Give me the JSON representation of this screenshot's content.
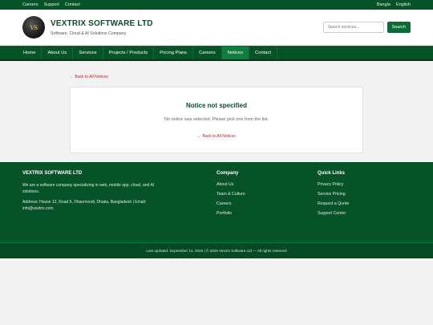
{
  "topbar": {
    "links": [
      "Careers",
      "Support",
      "Contact"
    ],
    "languages": [
      "Bangla",
      "English"
    ]
  },
  "header": {
    "logo_text": "VS",
    "company_name": "VEXTRIX SOFTWARE LTD",
    "tagline": "Software, Cloud & AI Solutions Company",
    "search_placeholder": "Search services...",
    "search_button": "Search"
  },
  "nav": {
    "items": [
      "Home",
      "About Us",
      "Services",
      "Projects / Products",
      "Pricing Plans",
      "Careers",
      "Notices",
      "Contact"
    ],
    "active": "Notices"
  },
  "main": {
    "back_link": "← Back to All Notices",
    "title": "Notice not specified",
    "message": "No notice was selected. Please pick one from the list.",
    "card_back_link": "← Back to All Notices"
  },
  "footer": {
    "about_title": "VEXTRIX SOFTWARE LTD",
    "about_text": "We are a software company specializing in web, mobile app, cloud, and AI solutions.",
    "address": "Address: House 12, Road 5, Dhanmondi, Dhaka, Bangladesh | Email: info@vextrix.com",
    "company_title": "Company",
    "company_links": [
      "About Us",
      "Team & Culture",
      "Careers",
      "Portfolio"
    ],
    "quick_title": "Quick Links",
    "quick_links": [
      "Privacy Policy",
      "Service Pricing",
      "Request a Quote",
      "Support Center"
    ],
    "bottom_text": "Last updated: September 13, 2026 | © 2026 Vextrix Software Ltd — All rights reserved"
  },
  "colors": {
    "brand_green": "#075328",
    "accent_green": "#0a6b34",
    "active_nav": "#0d7e40",
    "link_red": "#b02a2a"
  }
}
